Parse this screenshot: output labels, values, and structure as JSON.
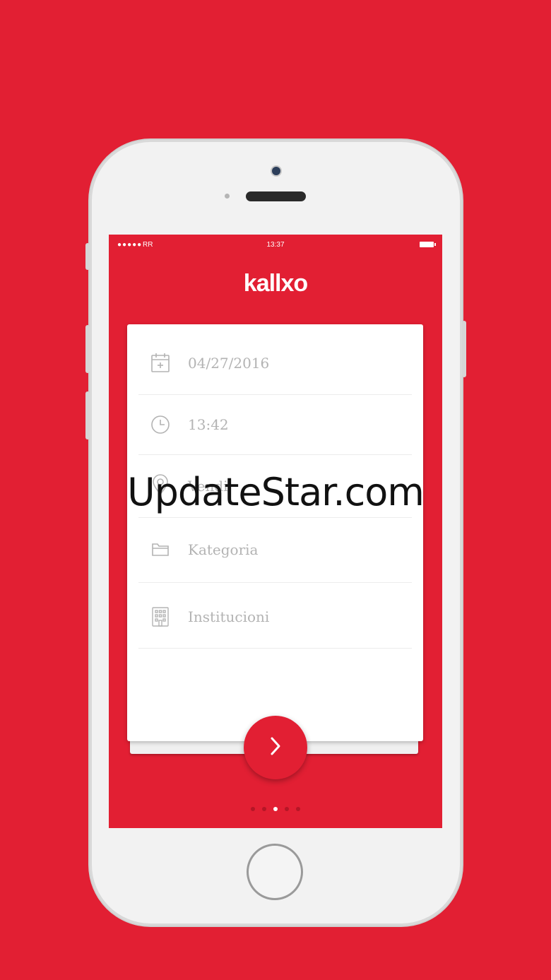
{
  "status_bar": {
    "signal": "●●●●●",
    "carrier": "RR",
    "time": "13:37"
  },
  "app": {
    "logo": "kallxo"
  },
  "form": {
    "rows": [
      {
        "icon": "calendar-add-icon",
        "value": "04/27/2016"
      },
      {
        "icon": "clock-icon",
        "value": "13:42"
      },
      {
        "icon": "location-pin-icon",
        "value": "Vendi"
      },
      {
        "icon": "folder-icon",
        "value": "Kategoria"
      },
      {
        "icon": "building-icon",
        "value": "Institucioni"
      }
    ]
  },
  "pager": {
    "count": 5,
    "active_index": 2
  },
  "watermark": {
    "text": "UpdateStar.com"
  },
  "colors": {
    "brand": "#e21f33",
    "placeholder": "#b3b3b3"
  }
}
